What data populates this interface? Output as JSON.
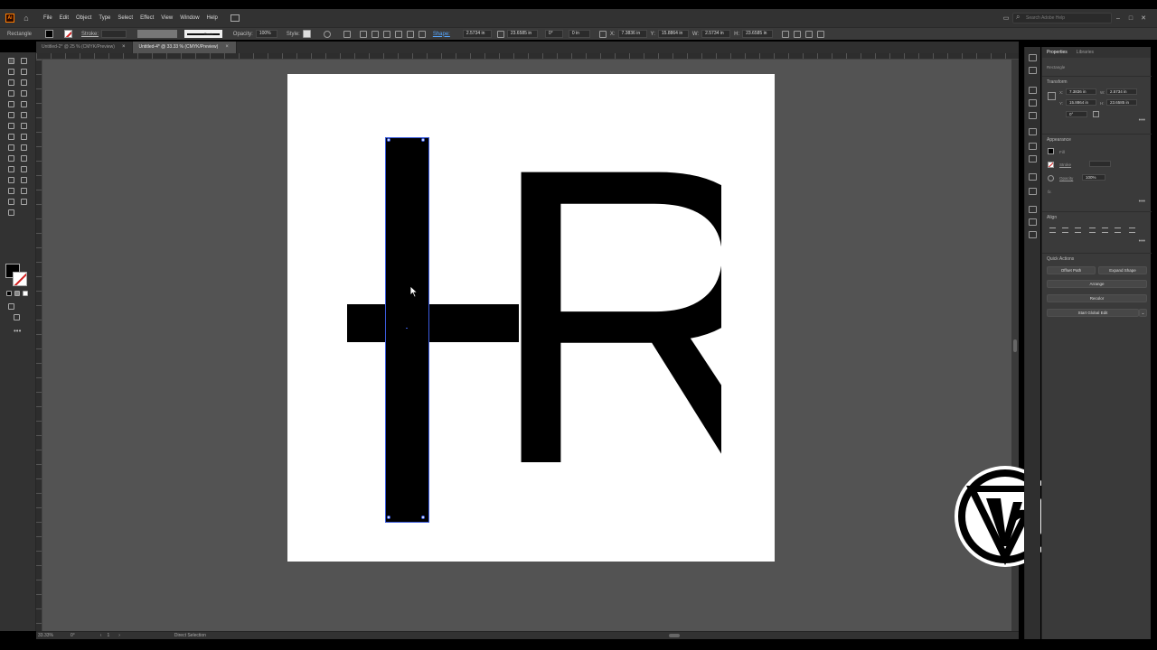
{
  "app": {
    "icon_text": "Ai"
  },
  "menu": [
    "File",
    "Edit",
    "Object",
    "Type",
    "Select",
    "Effect",
    "View",
    "Window",
    "Help"
  ],
  "search": {
    "placeholder": "Search Adobe Help"
  },
  "control_bar": {
    "selection_label": "Rectangle",
    "stroke_label": "Stroke:",
    "stroke_style_value": "Basic",
    "opacity_label": "Opacity:",
    "opacity_value": "100%",
    "style_label": "Style:",
    "shape_label": "Shape:",
    "width_value": "2.5734 in",
    "height_value": "23.6585 in",
    "angle_value": "0°",
    "corner_value": "0 in",
    "x_label": "X:",
    "x_value": "7.3836 in",
    "y_label": "Y:",
    "y_value": "15.8864 in",
    "w_label": "W:",
    "w_value": "2.5734 in",
    "h_label": "H:",
    "h_value": "23.6585 in"
  },
  "tabs": [
    {
      "label": "Untitled-2* @ 25 % (CMYK/Preview)",
      "active": false
    },
    {
      "label": "Untitled-4* @ 33.33 % (CMYK/Preview)",
      "active": true
    }
  ],
  "tab_close_glyph": "×",
  "artwork": {
    "letter": "R"
  },
  "status": {
    "zoom": "33.33%",
    "rotation": "0°",
    "artboard": "1",
    "tool": "Direct Selection"
  },
  "properties_panel": {
    "tab_properties": "Properties",
    "tab_libraries": "Libraries",
    "selection_type": "Rectangle",
    "transform_title": "Transform",
    "x_label": "X:",
    "x_value": "7.3836 in",
    "y_label": "Y:",
    "y_value": "15.8864 in",
    "w_label": "W:",
    "w_value": "2.5734 in",
    "h_label": "H:",
    "h_value": "23.6585 in",
    "angle_value": "0°",
    "appearance_title": "Appearance",
    "fill_label": "Fill",
    "stroke_label": "Stroke",
    "opacity_label": "Opacity",
    "opacity_value": "100%",
    "fx_label": "fx.",
    "align_title": "Align",
    "quick_actions_title": "Quick Actions",
    "btn_offset_path": "Offset Path",
    "btn_expand_shape": "Expand Shape",
    "btn_arrange": "Arrange",
    "btn_recolor": "Recolor",
    "btn_global_edit": "Start Global Edit",
    "more_glyph": "•••"
  },
  "colors": {
    "ui_dark": "#323232",
    "canvas": "#535353",
    "selection": "#3b5bdc",
    "stroke_none_red": "#d21e1e",
    "app_orange": "#ff7c00"
  }
}
